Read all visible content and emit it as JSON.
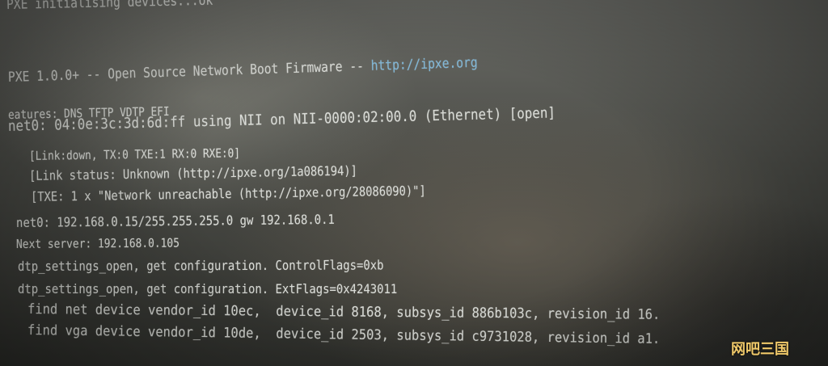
{
  "console": {
    "l01": "PXE initialising devices...ok",
    "l02a": "PXE 1.0.0+ -- Open Source Network Boot Firmware -- ",
    "l02b": "http://ipxe.org",
    "l03": "eatures: DNS TFTP VDTP EFI",
    "l04": "net0: 04:0e:3c:3d:6d:ff using NII on NII-0000:02:00.0 (Ethernet) [open]",
    "l05": "[Link:down, TX:0 TXE:1 RX:0 RXE:0]",
    "l06": "[Link status: Unknown (http://ipxe.org/1a086194)]",
    "l07": "[TXE: 1 x \"Network unreachable (http://ipxe.org/28086090)\"]",
    "l08": "net0: 192.168.0.15/255.255.255.0 gw 192.168.0.1",
    "l09": "Next server: 192.168.0.105",
    "l10": "dtp_settings_open, get configuration. ControlFlags=0xb",
    "l11": "dtp_settings_open, get configuration. ExtFlags=0x4243011",
    "l12": "find net device vendor_id 10ec,  device_id 8168, subsys_id 886b103c, revision_id 16.",
    "l13": "find vga device vendor_id 10de,  device_id 2503, subsys_id c9731028, revision_id a1."
  },
  "watermark": "网吧三国",
  "colors": {
    "text": "#d9dbd6",
    "link": "#7fb7d8",
    "watermark": "#f0c96a"
  }
}
